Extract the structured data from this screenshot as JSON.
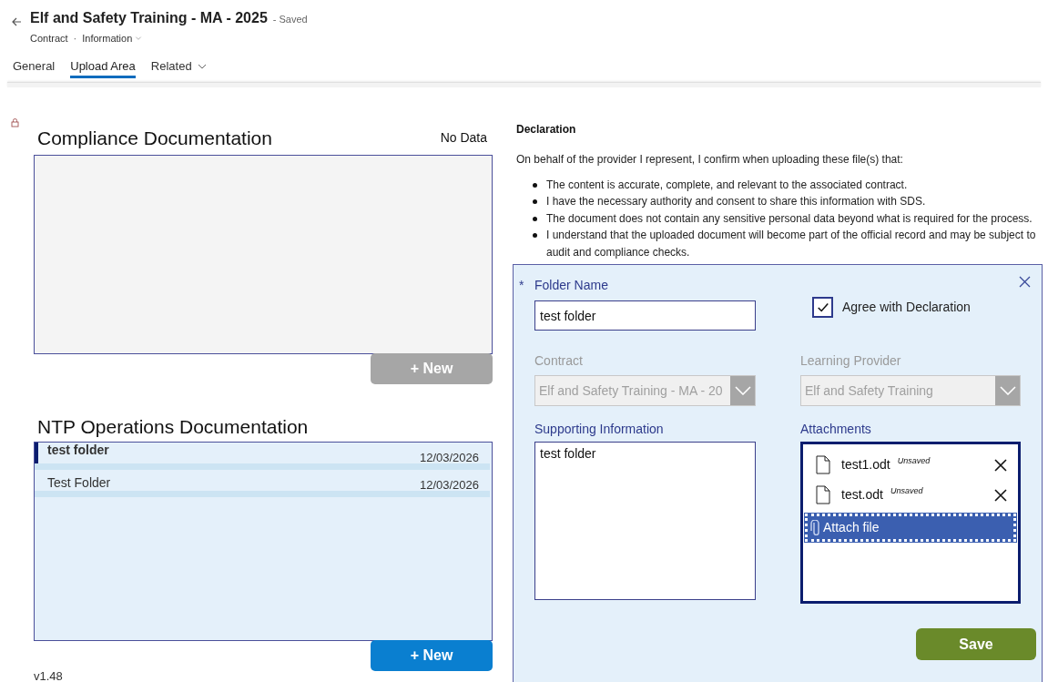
{
  "header": {
    "title": "Elf and Safety Training - MA - 2025",
    "status": "- Saved",
    "separator": "·",
    "breadcrumbs": [
      {
        "label": "Contract",
        "dropdown": false
      },
      {
        "label": "Information",
        "dropdown": true
      }
    ]
  },
  "tabs": [
    {
      "label": "General",
      "selected": false,
      "dropdown": false
    },
    {
      "label": "Upload Area",
      "selected": true,
      "dropdown": false
    },
    {
      "label": "Related",
      "selected": false,
      "dropdown": true
    }
  ],
  "compliance": {
    "title": "Compliance Documentation",
    "empty_text": "No Data",
    "new_button": {
      "label": "+ New",
      "disabled": true
    }
  },
  "ntp": {
    "title": "NTP Operations Documentation",
    "rows": [
      {
        "name": "test folder",
        "date": "12/03/2026",
        "selected": true
      },
      {
        "name": "Test Folder",
        "date": "12/03/2026",
        "selected": false
      }
    ],
    "new_button": {
      "label": "+ New",
      "disabled": false
    }
  },
  "version": "v1.48",
  "declaration": {
    "heading": "Declaration",
    "intro": "On behalf of the provider I represent, I confirm when uploading these file(s) that:",
    "bullets": [
      "The content is accurate, complete, and relevant to the associated contract.",
      "I have the necessary authority and consent to share this information with SDS.",
      "The document does not contain any sensitive personal data beyond what is required for the process.",
      "I understand that the uploaded document will become part of the official record and may be subject to audit and compliance checks."
    ]
  },
  "form": {
    "folder_name": {
      "label": "Folder Name",
      "required_marker": "*",
      "value": "test folder"
    },
    "agree": {
      "label": "Agree with Declaration",
      "checked": true
    },
    "contract": {
      "label": "Contract",
      "value": "Elf and Safety Training - MA - 20",
      "disabled": true
    },
    "provider": {
      "label": "Learning Provider",
      "value": "Elf and Safety Training",
      "disabled": true
    },
    "supporting": {
      "label": "Supporting Information",
      "value": "test folder"
    },
    "attachments": {
      "label": "Attachments",
      "files": [
        {
          "name": "test1.odt",
          "status": "Unsaved"
        },
        {
          "name": "test.odt",
          "status": "Unsaved"
        }
      ],
      "attach_label": "Attach file"
    },
    "save": "Save"
  }
}
